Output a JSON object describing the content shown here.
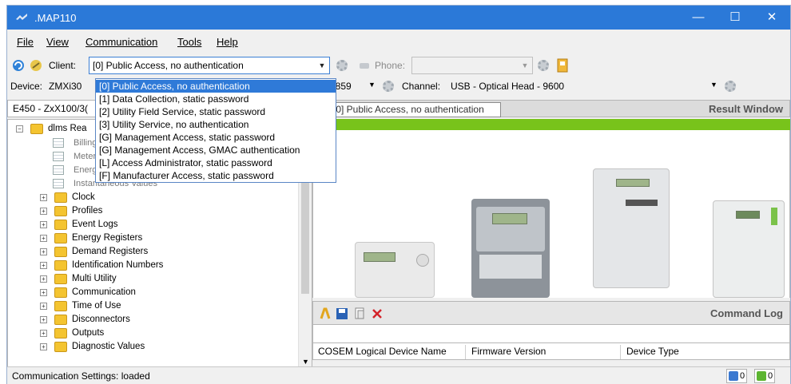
{
  "window": {
    "title": ".MAP110",
    "minimize": "—",
    "maximize": "☐",
    "close": "✕"
  },
  "menu": {
    "file": "File",
    "view": "View",
    "communication": "Communication",
    "tools": "Tools",
    "help": "Help"
  },
  "toolbar": {
    "client_label": "Client:",
    "client_value": "[0] Public Access, no authentication",
    "phone_label": "Phone:",
    "phone_value": ""
  },
  "device_row": {
    "device_label": "Device:",
    "device_value": "ZMXi30",
    "baud_value": "4859",
    "channel_label": "Channel:",
    "channel_value": "USB - Optical Head - 9600"
  },
  "client_dropdown": {
    "options": [
      "[0] Public Access, no authentication",
      "[1] Data Collection, static password",
      "[2] Utility Field Service, static password",
      "[3] Utility Service, no authentication",
      "[G] Management Access, static password",
      "[G] Management Access, GMAC authentication",
      "[L] Access Administrator, static password",
      "[F] Manufacturer Access, static password"
    ],
    "selected_index": 0
  },
  "tooltip": "[0] Public Access, no authentication",
  "left_panel": {
    "header": "E450 - ZxX100/3(",
    "root": "dlms Rea",
    "leaves": [
      "Billing",
      "Meter",
      "Energ",
      "Instantaneous Values"
    ],
    "folders": [
      "Clock",
      "Profiles",
      "Event Logs",
      "Energy Registers",
      "Demand Registers",
      "Identification Numbers",
      "Multi Utility",
      "Communication",
      "Time of Use",
      "Disconnectors",
      "Outputs",
      "Diagnostic Values"
    ]
  },
  "right_panel": {
    "result_window": "Result Window",
    "command_log": "Command Log",
    "columns": [
      "COSEM Logical Device Name",
      "Firmware Version",
      "Device Type"
    ]
  },
  "status": {
    "text": "Communication Settings: loaded",
    "down_count": "0",
    "up_count": "0"
  },
  "colors": {
    "titlebar": "#2b79d8",
    "selection": "#2f7ad8",
    "green_bar": "#78c31b"
  }
}
